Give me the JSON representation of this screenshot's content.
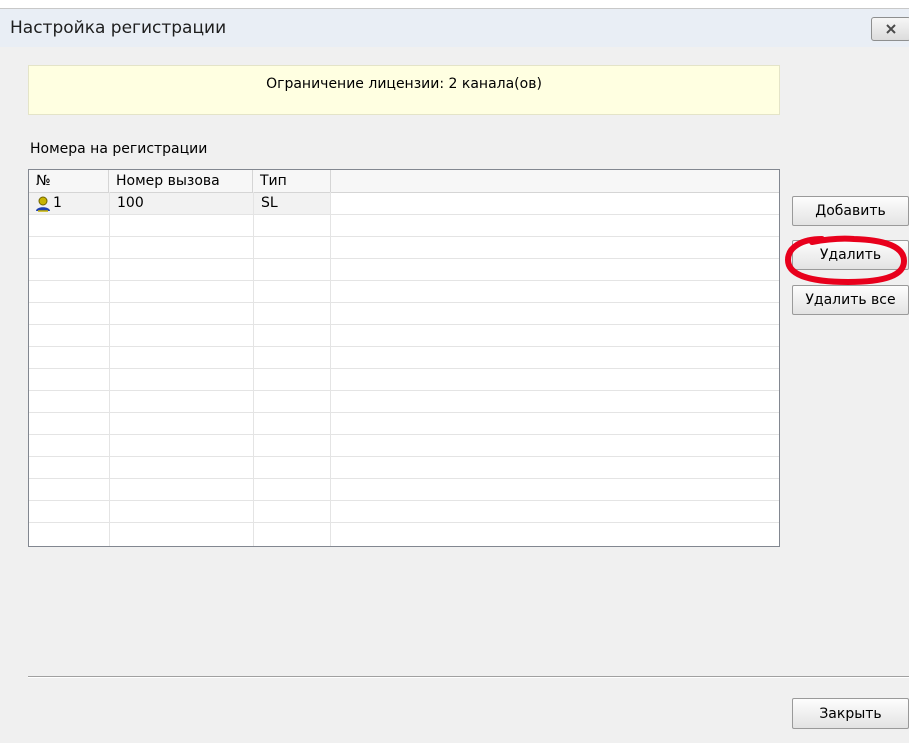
{
  "window": {
    "title": "Настройка регистрации"
  },
  "license": {
    "text": "Ограничение лицензии: 2 канала(ов)"
  },
  "registrations": {
    "label": "Номера на регистрации",
    "columns": [
      "№",
      "Номер вызова",
      "Тип"
    ],
    "rows": [
      {
        "index": "1",
        "number": "100",
        "type": "SL",
        "icon": "user-icon"
      }
    ]
  },
  "buttons": {
    "add": "Добавить",
    "delete": "Удалить",
    "delete_all": "Удалить все",
    "close": "Закрыть"
  },
  "icons": {
    "close": "close-x-icon",
    "row": "user-icon"
  },
  "colors": {
    "license_bg": "#ffffe1",
    "annotation": "#e8001c",
    "icon_head": "#c8b400",
    "icon_body": "#1e3fb0"
  }
}
